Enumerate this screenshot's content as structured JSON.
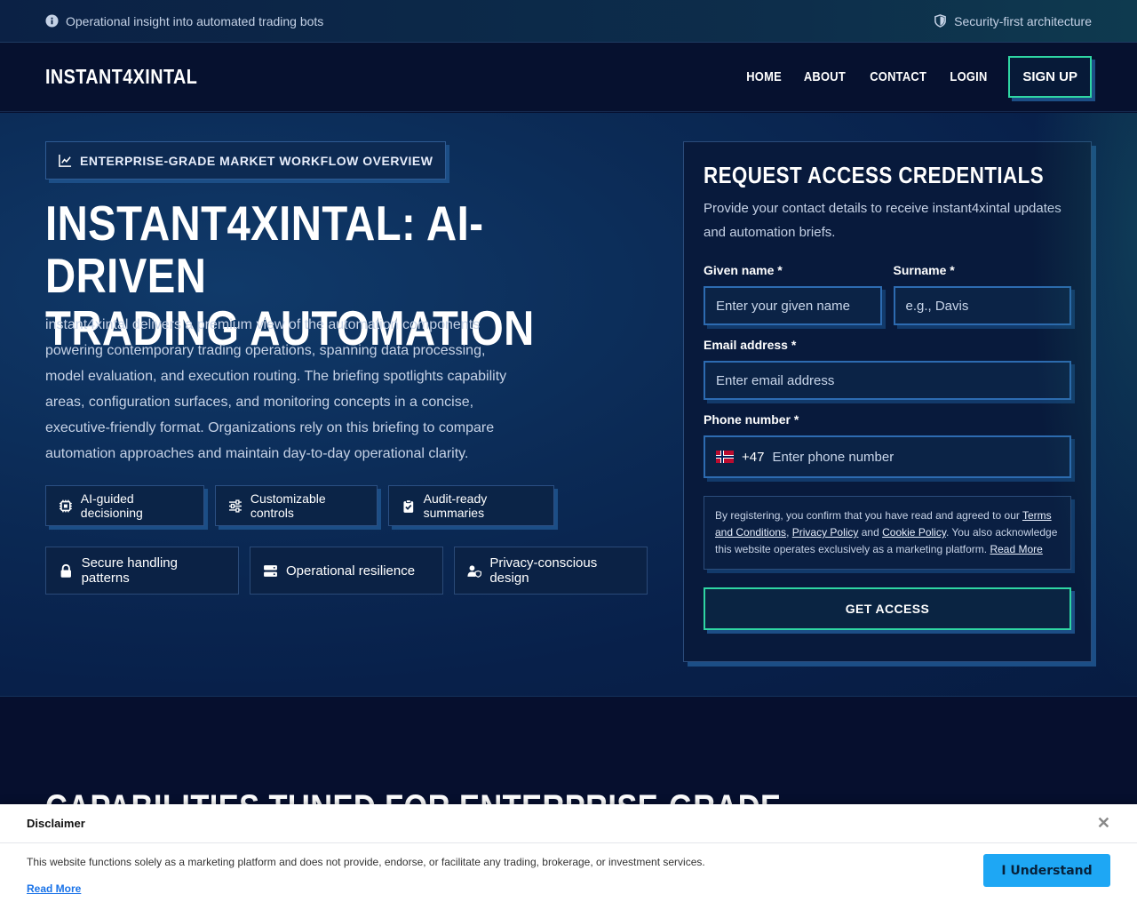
{
  "topbar": {
    "left_text": "Operational insight into automated trading bots",
    "right_text": "Security-first architecture"
  },
  "nav": {
    "logo": "INSTANT4XINTAL",
    "items": [
      "HOME",
      "ABOUT",
      "CONTACT",
      "LOGIN"
    ],
    "signup": "SIGN UP"
  },
  "hero": {
    "badge": "ENTERPRISE-GRADE MARKET WORKFLOW OVERVIEW",
    "title_line1": "INSTANT4XINTAL: AI-DRIVEN",
    "title_line2": "TRADING AUTOMATION",
    "lead": "instant4xintal delivers a premium view of the automation components powering contemporary trading operations, spanning data processing, model evaluation, and execution routing. The briefing spotlights capability areas, configuration surfaces, and monitoring concepts in a concise, executive-friendly format. Organizations rely on this briefing to compare automation approaches and maintain day-to-day operational clarity.",
    "chips": [
      {
        "label": "AI-guided decisioning",
        "icon": "chip-icon"
      },
      {
        "label": "Customizable controls",
        "icon": "sliders-icon"
      },
      {
        "label": "Audit-ready summaries",
        "icon": "clipboard-check-icon"
      },
      {
        "label": "Secure handling patterns",
        "icon": "lock-icon"
      },
      {
        "label": "Operational resilience",
        "icon": "server-icon"
      },
      {
        "label": "Privacy-conscious design",
        "icon": "user-shield-icon"
      }
    ]
  },
  "form": {
    "title": "REQUEST ACCESS CREDENTIALS",
    "subtitle": "Provide your contact details to receive instant4xintal updates and automation briefs.",
    "given_label": "Given name *",
    "given_placeholder": "Enter your given name",
    "surname_label": "Surname *",
    "surname_placeholder": "e.g., Davis",
    "email_label": "Email address *",
    "email_placeholder": "Enter email address",
    "phone_label": "Phone number *",
    "phone_code": "+47",
    "phone_placeholder": "Enter phone number",
    "terms_prefix": "By registering, you confirm that you have read and agreed to our ",
    "terms_link": "Terms and Conditions",
    "privacy_link": "Privacy Policy",
    "and": " and ",
    "cookie_link": "Cookie Policy",
    "terms_suffix": ". You also acknowledge this website operates exclusively as a marketing platform. ",
    "read_more": "Read More",
    "cta": "GET ACCESS"
  },
  "capabilities": {
    "title": "CAPABILITIES TUNED FOR ENTERPRISE-GRADE"
  },
  "disclaimer": {
    "title": "Disclaimer",
    "text": "This website functions solely as a marketing platform and does not provide, endorse, or facilitate any trading, brokerage, or investment services.",
    "read_more": "Read More",
    "button": "I Understand"
  },
  "colors": {
    "accent_green": "#2fd6a3",
    "accent_blue": "#1c4e86",
    "button_blue": "#1ea7f4",
    "bg_dark": "#060f2e"
  }
}
